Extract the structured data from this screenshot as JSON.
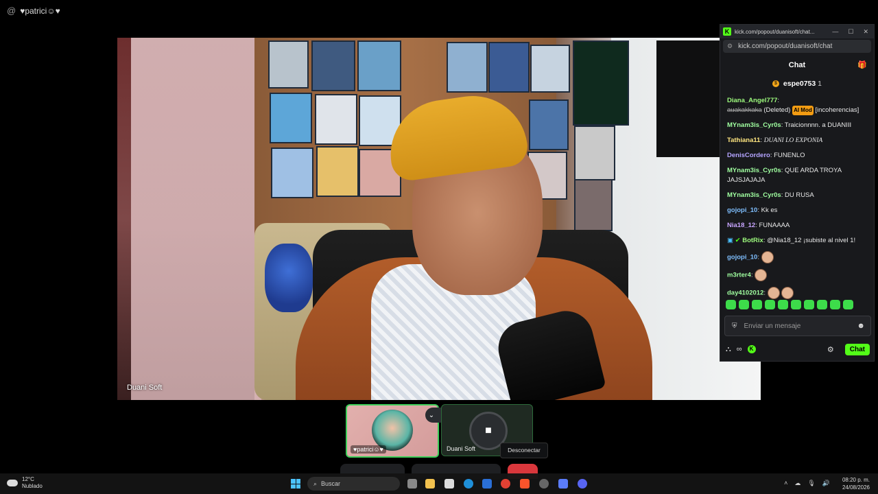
{
  "top_user": {
    "at": "@",
    "name": "♥patrici☺♥"
  },
  "video": {
    "label": "Duani Soft"
  },
  "chat_window": {
    "title": "kick.com/popout/duanisoft/chat...",
    "url": "kick.com/popout/duanisoft/chat",
    "header": "Chat",
    "pinned_user": "espe0753",
    "pinned_count": "1",
    "messages": [
      {
        "user": "Diana_Angel777",
        "deleted_text": "auakakkaka",
        "deleted_tag": "(Deleted)",
        "badge": "AI Mod",
        "note": "[incoherencias]"
      },
      {
        "user": "MYnam3is_Cyr0s",
        "text": "Traicionnnn. a DUANIII"
      },
      {
        "user": "Tathiana11",
        "text": "DUANI LO EXPONIA"
      },
      {
        "user": "DenisCordero",
        "text": "FUNENLO"
      },
      {
        "user": "MYnam3is_Cyr0s",
        "text": "QUE ARDA TROYA JAJSJAJAJA"
      },
      {
        "user": "MYnam3is_Cyr0s",
        "text": "DU RUSA"
      },
      {
        "user": "gojopi_10",
        "text": "Kk es"
      },
      {
        "user": "Nia18_12",
        "text": "FUNAAAA"
      },
      {
        "user": "BotRix",
        "text": "@Nia18_12 ¡subiste al nivel 1!"
      },
      {
        "user": "gojopi_10",
        "text": ""
      },
      {
        "user": "m3rter4",
        "text": ""
      },
      {
        "user": "day4102012",
        "text": ""
      }
    ],
    "input_placeholder": "Enviar un mensaje",
    "send_label": "Chat"
  },
  "tiles": {
    "tile1_name": "♥patrici☺♥",
    "tile2_name": "Duani Soft",
    "tooltip": "Desconectar"
  },
  "taskbar": {
    "temp": "12°C",
    "weather": "Nublado",
    "search": "Buscar",
    "time": "08:20 p. m.",
    "date": "24/08/2026"
  },
  "colors": {
    "kick_green": "#53fc18",
    "disconnect_red": "#da373c"
  }
}
